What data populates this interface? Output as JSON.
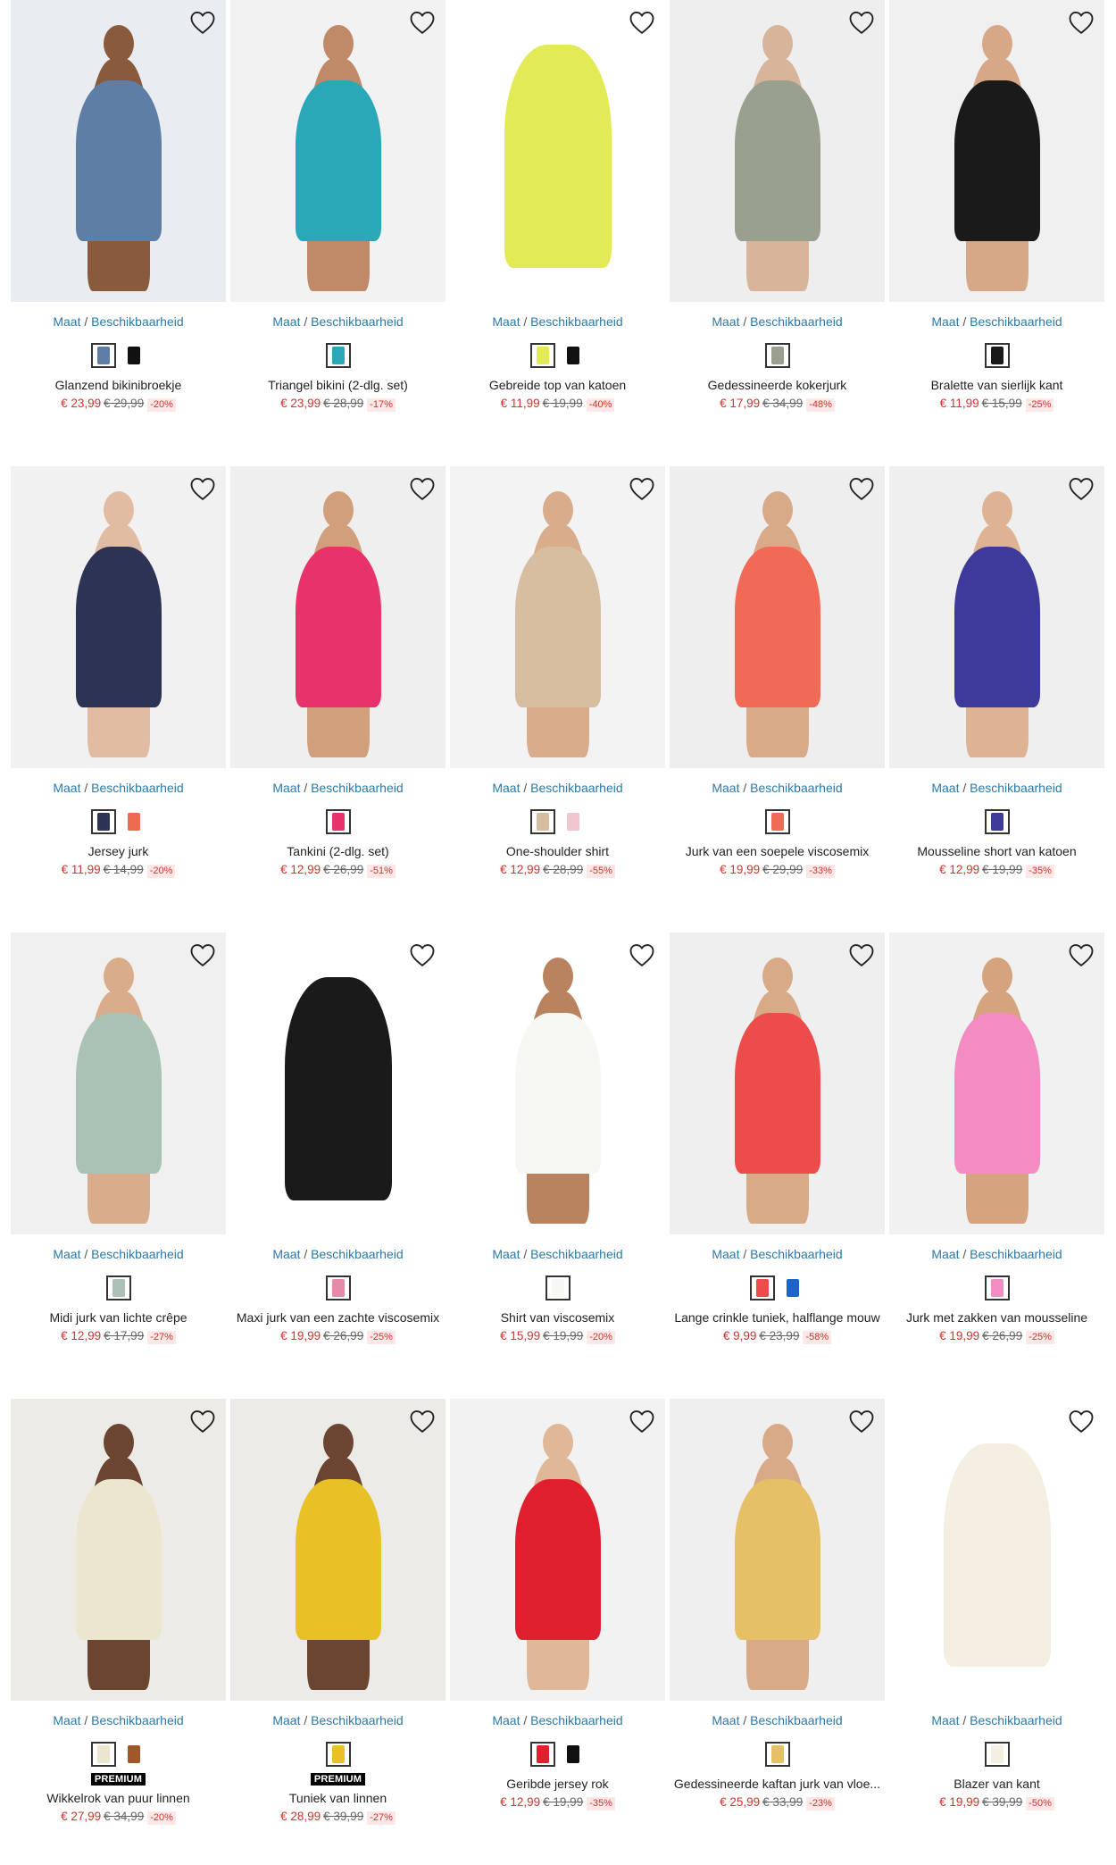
{
  "labels": {
    "maat": "Maat",
    "separator": "/",
    "beschikbaarheid": "Beschikbaarheid"
  },
  "icons": {
    "wishlist": "heart-outline-icon"
  },
  "products": [
    {
      "title": "Glanzend bikinibroekje",
      "price": "€ 23,99",
      "old_price": "€ 29,99",
      "discount": "-20%",
      "premium": "",
      "bg": "#e9edf1",
      "garment": "#5f7ea6",
      "skin": "#8a5a3c",
      "swatches": [
        "#5f7ea6",
        "#111111"
      ]
    },
    {
      "title": "Triangel bikini (2-dlg. set)",
      "price": "€ 23,99",
      "old_price": "€ 28,99",
      "discount": "-17%",
      "premium": "",
      "bg": "#f2f2f2",
      "garment": "#2aa8b8",
      "skin": "#c08a68",
      "swatches": [
        "#2aa8b8"
      ]
    },
    {
      "title": "Gebreide top van katoen",
      "price": "€ 11,99",
      "old_price": "€ 19,99",
      "discount": "-40%",
      "premium": "",
      "bg": "#ffffff",
      "garment": "#e2ea55",
      "skin": "",
      "swatches": [
        "#e2ea55",
        "#111111"
      ]
    },
    {
      "title": "Gedessineerde kokerjurk",
      "price": "€ 17,99",
      "old_price": "€ 34,99",
      "discount": "-48%",
      "premium": "",
      "bg": "#eeeeee",
      "garment": "#9aa08e",
      "skin": "#d8b49a",
      "swatches": [
        "#9aa08e"
      ]
    },
    {
      "title": "Bralette van sierlijk kant",
      "price": "€ 11,99",
      "old_price": "€ 15,99",
      "discount": "-25%",
      "premium": "",
      "bg": "#f0f0f0",
      "garment": "#1a1a1a",
      "skin": "#d7a888",
      "swatches": [
        "#1a1a1a"
      ]
    },
    {
      "title": "Jersey jurk",
      "price": "€ 11,99",
      "old_price": "€ 14,99",
      "discount": "-20%",
      "premium": "",
      "bg": "#f1f1f1",
      "garment": "#2c3354",
      "skin": "#e2bca2",
      "swatches": [
        "#2c3354",
        "#ef6a52"
      ]
    },
    {
      "title": "Tankini (2-dlg. set)",
      "price": "€ 12,99",
      "old_price": "€ 26,99",
      "discount": "-51%",
      "premium": "",
      "bg": "#efefef",
      "garment": "#e8336a",
      "skin": "#d29f7d",
      "swatches": [
        "#e8336a"
      ]
    },
    {
      "title": "One-shoulder shirt",
      "price": "€ 12,99",
      "old_price": "€ 28,99",
      "discount": "-55%",
      "premium": "",
      "bg": "#f3f3f3",
      "garment": "#d8bea0",
      "skin": "#d9ad8c",
      "swatches": [
        "#d8bea0",
        "#f2c6d0"
      ]
    },
    {
      "title": "Jurk van een soepele viscosemix",
      "price": "€ 19,99",
      "old_price": "€ 29,99",
      "discount": "-33%",
      "premium": "",
      "bg": "#eeeeee",
      "garment": "#f06a55",
      "skin": "#d8aa88",
      "swatches": [
        "#f06a55"
      ]
    },
    {
      "title": "Mousseline short van katoen",
      "price": "€ 12,99",
      "old_price": "€ 19,99",
      "discount": "-35%",
      "premium": "",
      "bg": "#efefef",
      "garment": "#3e3a9a",
      "skin": "#deb394",
      "swatches": [
        "#3e3a9a"
      ]
    },
    {
      "title": "Midi jurk van lichte crêpe",
      "price": "€ 12,99",
      "old_price": "€ 17,99",
      "discount": "-27%",
      "premium": "",
      "bg": "#f0f0f0",
      "garment": "#a9c2b4",
      "skin": "#d9ad8c",
      "swatches": [
        "#a9c2b4"
      ]
    },
    {
      "title": "Maxi jurk van een zachte viscosemix",
      "price": "€ 19,99",
      "old_price": "€ 26,99",
      "discount": "-25%",
      "premium": "",
      "bg": "#ffffff",
      "garment": "#1a1a1a",
      "skin": "",
      "swatches": [
        "#e68aa8"
      ]
    },
    {
      "title": "Shirt van viscosemix",
      "price": "€ 15,99",
      "old_price": "€ 19,99",
      "discount": "-20%",
      "premium": "",
      "bg": "#ffffff",
      "garment": "#f7f7f4",
      "skin": "#b8835e",
      "swatches": [
        "#f7f7f4"
      ]
    },
    {
      "title": "Lange crinkle tuniek, halflange mouw",
      "price": "€ 9,99",
      "old_price": "€ 23,99",
      "discount": "-58%",
      "premium": "",
      "bg": "#efefef",
      "garment": "#ee4b4b",
      "skin": "#d8aa88",
      "swatches": [
        "#ee4b4b",
        "#1e63c8"
      ]
    },
    {
      "title": "Jurk met zakken van mousseline",
      "price": "€ 19,99",
      "old_price": "€ 26,99",
      "discount": "-25%",
      "premium": "",
      "bg": "#f1f1f1",
      "garment": "#f28cc2",
      "skin": "#d6a37f",
      "swatches": [
        "#f28cc2"
      ]
    },
    {
      "title": "Wikkelrok van puur linnen",
      "price": "€ 27,99",
      "old_price": "€ 34,99",
      "discount": "-20%",
      "premium": "PREMIUM",
      "bg": "#ecebe6",
      "garment": "#ece6cf",
      "skin": "#6b4532",
      "swatches": [
        "#ece6cf",
        "#a0582a"
      ]
    },
    {
      "title": "Tuniek van linnen",
      "price": "€ 28,99",
      "old_price": "€ 39,99",
      "discount": "-27%",
      "premium": "PREMIUM",
      "bg": "#ecebe7",
      "garment": "#e8c126",
      "skin": "#6b4532",
      "swatches": [
        "#e8c126"
      ]
    },
    {
      "title": "Geribde jersey rok",
      "price": "€ 12,99",
      "old_price": "€ 19,99",
      "discount": "-35%",
      "premium": "",
      "bg": "#f2f2f2",
      "garment": "#e0202e",
      "skin": "#e0b898",
      "swatches": [
        "#e0202e",
        "#111111"
      ]
    },
    {
      "title": "Gedessineerde kaftan jurk van vloe...",
      "price": "€ 25,99",
      "old_price": "€ 33,99",
      "discount": "-23%",
      "premium": "",
      "bg": "#efefef",
      "garment": "#e6c066",
      "skin": "#d8aa88",
      "swatches": [
        "#e6c066"
      ]
    },
    {
      "title": "Blazer van kant",
      "price": "€ 19,99",
      "old_price": "€ 39,99",
      "discount": "-50%",
      "premium": "",
      "bg": "#ffffff",
      "garment": "#f4efe1",
      "skin": "",
      "swatches": [
        "#f4efe1"
      ]
    }
  ]
}
